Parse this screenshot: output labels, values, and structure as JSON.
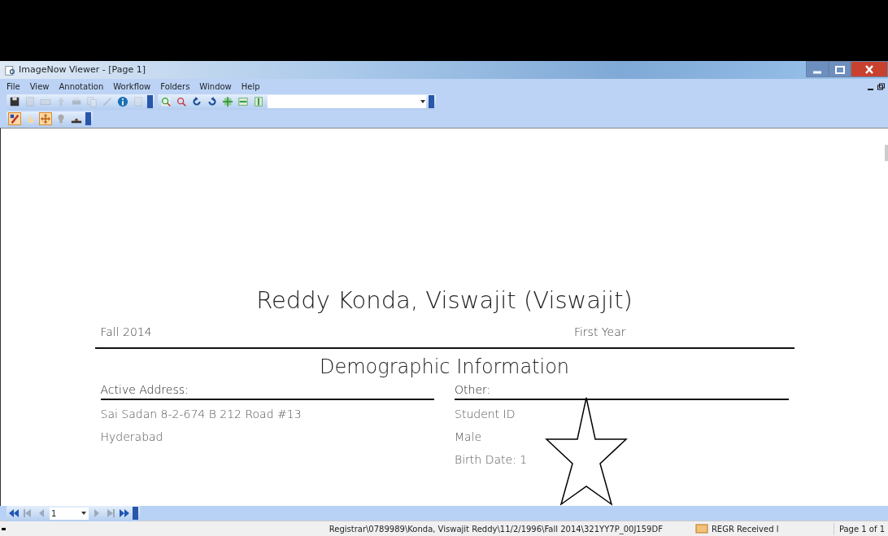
{
  "window": {
    "title": "ImageNow Viewer - [Page 1]"
  },
  "menu": [
    "File",
    "View",
    "Annotation",
    "Workflow",
    "Folders",
    "Window",
    "Help"
  ],
  "toolbar_main": [
    {
      "kind": "save",
      "disabled": false
    },
    {
      "kind": "doc",
      "disabled": true
    },
    {
      "kind": "scan",
      "disabled": true
    },
    {
      "kind": "upload",
      "disabled": true
    },
    {
      "kind": "print",
      "disabled": true
    },
    {
      "kind": "copy",
      "disabled": true
    },
    {
      "kind": "pen",
      "disabled": true
    },
    {
      "kind": "info",
      "disabled": false
    },
    {
      "kind": "paste",
      "disabled": true
    }
  ],
  "toolbar_view": [
    {
      "kind": "zoomin"
    },
    {
      "kind": "zoomout"
    },
    {
      "kind": "rotl"
    },
    {
      "kind": "rotr"
    },
    {
      "kind": "fit"
    },
    {
      "kind": "fitw"
    },
    {
      "kind": "fith"
    }
  ],
  "toolbar_annot": [
    {
      "kind": "marker",
      "selected": true
    },
    {
      "kind": "hand",
      "selected": false
    },
    {
      "kind": "move",
      "selected": true
    },
    {
      "kind": "stamp",
      "selected": false
    },
    {
      "kind": "seal",
      "selected": false
    }
  ],
  "document": {
    "name": "Reddy Konda, Viswajit  (Viswajit)",
    "term": "Fall 2014",
    "level": "First Year",
    "section": "Demographic Information",
    "columns": [
      {
        "heading": "Active Address:",
        "lines": [
          "Sai Sadan 8-2-674 B 212 Road #13",
          "Hyderabad"
        ]
      },
      {
        "heading": "Other:",
        "lines": [
          "Student ID",
          "Male",
          "Birth Date: 1"
        ]
      }
    ]
  },
  "pager": {
    "page": "1"
  },
  "status_bar": {
    "path": "Registrar\\0789989\\Konda, Viswajit Reddy\\11/2/1996\\Fall 2014\\321YY7P_00J159DF",
    "queue": "REGR Received l",
    "pages": "Page 1 of 1"
  }
}
